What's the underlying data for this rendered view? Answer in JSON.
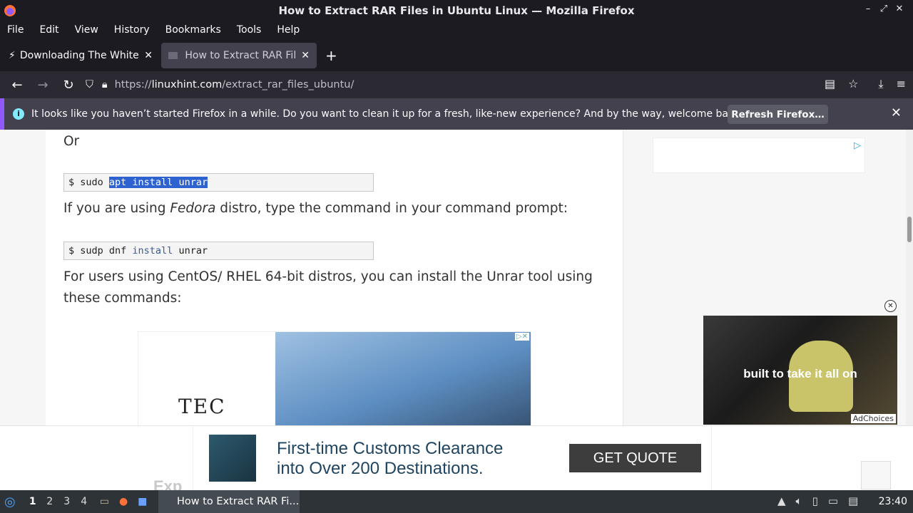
{
  "window": {
    "title": "How to Extract RAR Files in Ubuntu Linux — Mozilla Firefox"
  },
  "menu": [
    "File",
    "Edit",
    "View",
    "History",
    "Bookmarks",
    "Tools",
    "Help"
  ],
  "tabs": [
    {
      "label": "Downloading The White House"
    },
    {
      "label": "How to Extract RAR Files in Ubuntu Linux"
    }
  ],
  "address": {
    "scheme": "https://",
    "host": "linuxhint.com",
    "path": "/extract_rar_files_ubuntu/"
  },
  "infobar": {
    "message": "It looks like you haven’t started Firefox in a while. Do you want to clean it up for a fresh, like-new experience? And by the way, welcome back!",
    "button": "Refresh Firefox…"
  },
  "article": {
    "or": "Or",
    "cmd1": {
      "prompt": "$ sudo ",
      "selected": "apt install unrar"
    },
    "fedora": {
      "pre": "If you are using ",
      "em": "Fedora",
      "post": " distro, type the command in your command prompt:"
    },
    "cmd2": {
      "prompt": "$ sudp dnf ",
      "kw": "install",
      "post": " unrar"
    },
    "centos": "For users using CentOS/ RHEL 64-bit distros, you can install the Unrar tool using these commands:"
  },
  "ads": {
    "inline_logo": "TEC",
    "video_caption": "built to take it all on",
    "adchoices": "AdChoices",
    "bottom_headline_1": "First-time Customs Clearance",
    "bottom_headline_2": "into Over 200 Destinations.",
    "bottom_cta": "GET QUOTE",
    "ghost": "Exp"
  },
  "taskbar": {
    "workspaces": [
      "1",
      "2",
      "3",
      "4"
    ],
    "task": "How to Extract RAR Fi...",
    "clock": "23:40"
  }
}
